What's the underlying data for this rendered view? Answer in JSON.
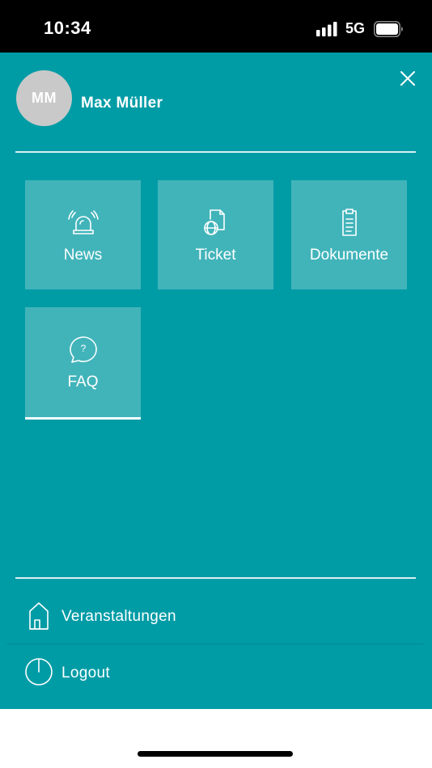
{
  "status_bar": {
    "time": "10:34",
    "network": "5G",
    "signal_icon": "cellular-signal-icon",
    "battery_icon": "battery-icon"
  },
  "colors": {
    "panel_bg": "#009ca6",
    "tile_bg": "#41b4ba",
    "avatar_bg": "#c9c9c9",
    "text": "#ffffff"
  },
  "profile": {
    "initials": "MM",
    "name": "Max Müller"
  },
  "tiles": [
    {
      "label": "News",
      "icon": "alarm-siren-icon"
    },
    {
      "label": "Ticket",
      "icon": "ticket-document-icon"
    },
    {
      "label": "Dokumente",
      "icon": "clipboard-icon"
    },
    {
      "label": "FAQ",
      "icon": "question-bubble-icon",
      "active": true
    }
  ],
  "menu": [
    {
      "label": "Veranstaltungen",
      "icon": "building-icon"
    },
    {
      "label": "Logout",
      "icon": "power-icon"
    }
  ]
}
